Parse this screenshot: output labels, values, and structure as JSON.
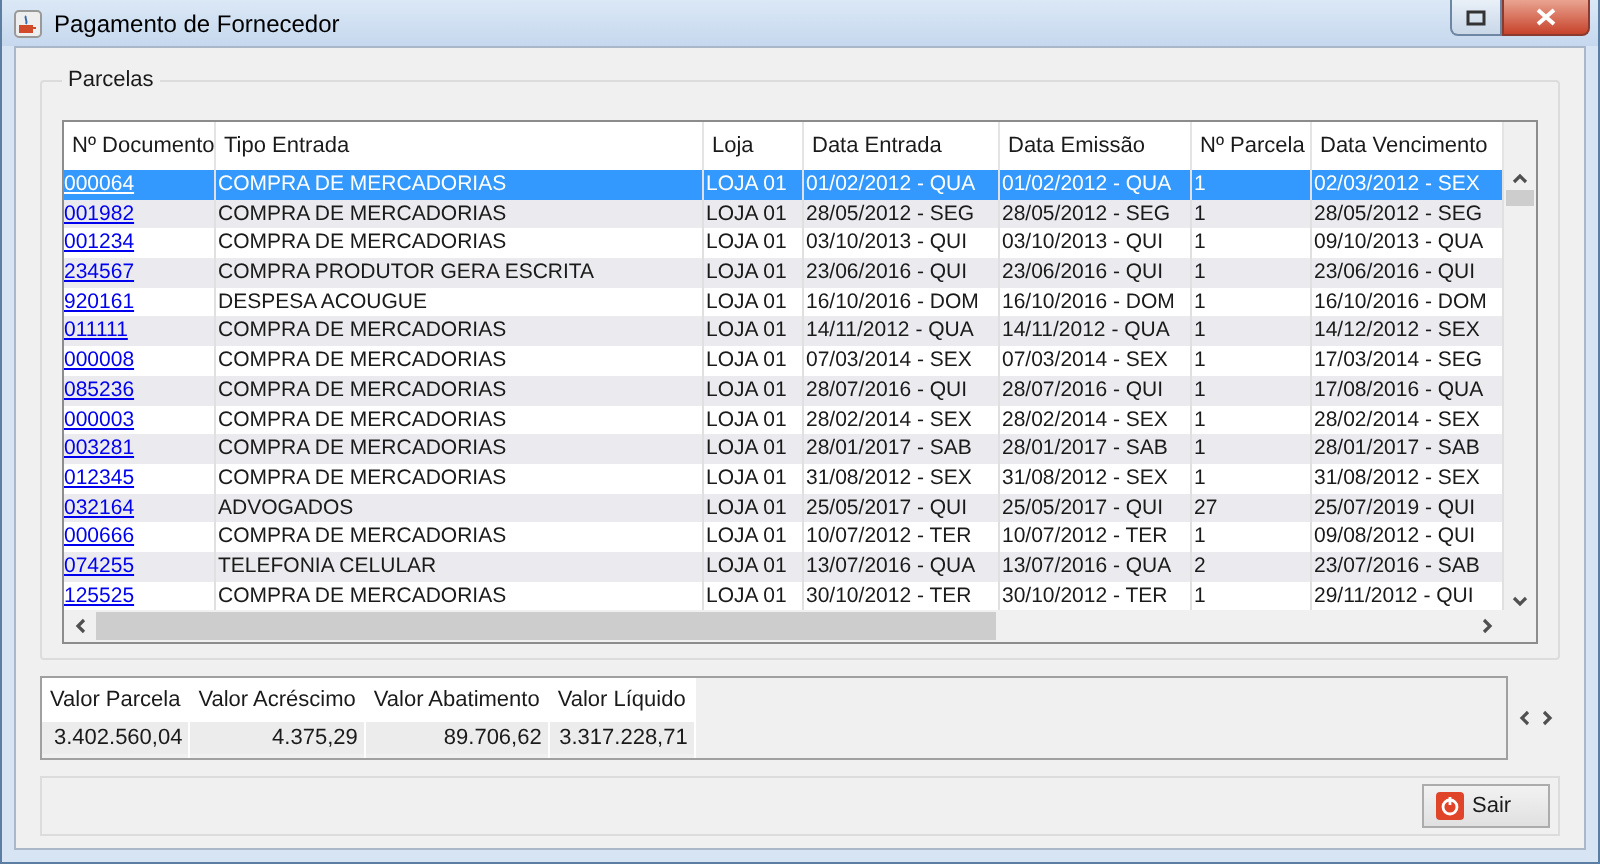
{
  "window": {
    "title": "Pagamento de Fornecedor"
  },
  "parcelas": {
    "title": "Parcelas",
    "columns": [
      "Nº Documento",
      "Tipo Entrada",
      "Loja",
      "Data Entrada",
      "Data Emissão",
      "Nº Parcela",
      "Data Vencimento"
    ],
    "rows": [
      {
        "selected": true,
        "cells": [
          "000064",
          "COMPRA DE MERCADORIAS",
          "LOJA 01",
          "01/02/2012 - QUA",
          "01/02/2012 - QUA",
          "1",
          "02/03/2012 - SEX"
        ]
      },
      {
        "selected": false,
        "cells": [
          "001982",
          "COMPRA DE MERCADORIAS",
          "LOJA 01",
          "28/05/2012 - SEG",
          "28/05/2012 - SEG",
          "1",
          "28/05/2012 - SEG"
        ]
      },
      {
        "selected": false,
        "cells": [
          "001234",
          "COMPRA DE MERCADORIAS",
          "LOJA 01",
          "03/10/2013 - QUI",
          "03/10/2013 - QUI",
          "1",
          "09/10/2013 - QUA"
        ]
      },
      {
        "selected": false,
        "cells": [
          "234567",
          "COMPRA PRODUTOR GERA ESCRITA",
          "LOJA 01",
          "23/06/2016 - QUI",
          "23/06/2016 - QUI",
          "1",
          "23/06/2016 - QUI"
        ]
      },
      {
        "selected": false,
        "cells": [
          "920161",
          "DESPESA ACOUGUE",
          "LOJA 01",
          "16/10/2016 - DOM",
          "16/10/2016 - DOM",
          "1",
          "16/10/2016 - DOM"
        ]
      },
      {
        "selected": false,
        "cells": [
          "011111",
          "COMPRA DE MERCADORIAS",
          "LOJA 01",
          "14/11/2012 - QUA",
          "14/11/2012 - QUA",
          "1",
          "14/12/2012 - SEX"
        ]
      },
      {
        "selected": false,
        "cells": [
          "000008",
          "COMPRA DE MERCADORIAS",
          "LOJA 01",
          "07/03/2014 - SEX",
          "07/03/2014 - SEX",
          "1",
          "17/03/2014 - SEG"
        ]
      },
      {
        "selected": false,
        "cells": [
          "085236",
          "COMPRA DE MERCADORIAS",
          "LOJA 01",
          "28/07/2016 - QUI",
          "28/07/2016 - QUI",
          "1",
          "17/08/2016 - QUA"
        ]
      },
      {
        "selected": false,
        "cells": [
          "000003",
          "COMPRA DE MERCADORIAS",
          "LOJA 01",
          "28/02/2014 - SEX",
          "28/02/2014 - SEX",
          "1",
          "28/02/2014 - SEX"
        ]
      },
      {
        "selected": false,
        "cells": [
          "003281",
          "COMPRA DE MERCADORIAS",
          "LOJA 01",
          "28/01/2017 - SAB",
          "28/01/2017 - SAB",
          "1",
          "28/01/2017 - SAB"
        ]
      },
      {
        "selected": false,
        "cells": [
          "012345",
          "COMPRA DE MERCADORIAS",
          "LOJA 01",
          "31/08/2012 - SEX",
          "31/08/2012 - SEX",
          "1",
          "31/08/2012 - SEX"
        ]
      },
      {
        "selected": false,
        "cells": [
          "032164",
          "ADVOGADOS",
          "LOJA 01",
          "25/05/2017 - QUI",
          "25/05/2017 - QUI",
          "27",
          "25/07/2019 - QUI"
        ]
      },
      {
        "selected": false,
        "cells": [
          "000666",
          "COMPRA DE MERCADORIAS",
          "LOJA 01",
          "10/07/2012 - TER",
          "10/07/2012 - TER",
          "1",
          "09/08/2012 - QUI"
        ]
      },
      {
        "selected": false,
        "cells": [
          "074255",
          "TELEFONIA CELULAR",
          "LOJA 01",
          "13/07/2016 - QUA",
          "13/07/2016 - QUA",
          "2",
          "23/07/2016 - SAB"
        ]
      },
      {
        "selected": false,
        "cells": [
          "125525",
          "COMPRA DE MERCADORIAS",
          "LOJA 01",
          "30/10/2012 - TER",
          "30/10/2012 - TER",
          "1",
          "29/11/2012 - QUI"
        ]
      }
    ]
  },
  "totals": [
    {
      "label": "Valor Parcela",
      "value": "3.402.560,04"
    },
    {
      "label": "Valor Acréscimo",
      "value": "4.375,29"
    },
    {
      "label": "Valor Abatimento",
      "value": "89.706,62"
    },
    {
      "label": "Valor Líquido",
      "value": "3.317.228,71"
    }
  ],
  "buttons": [
    {
      "label": "Sair"
    }
  ]
}
